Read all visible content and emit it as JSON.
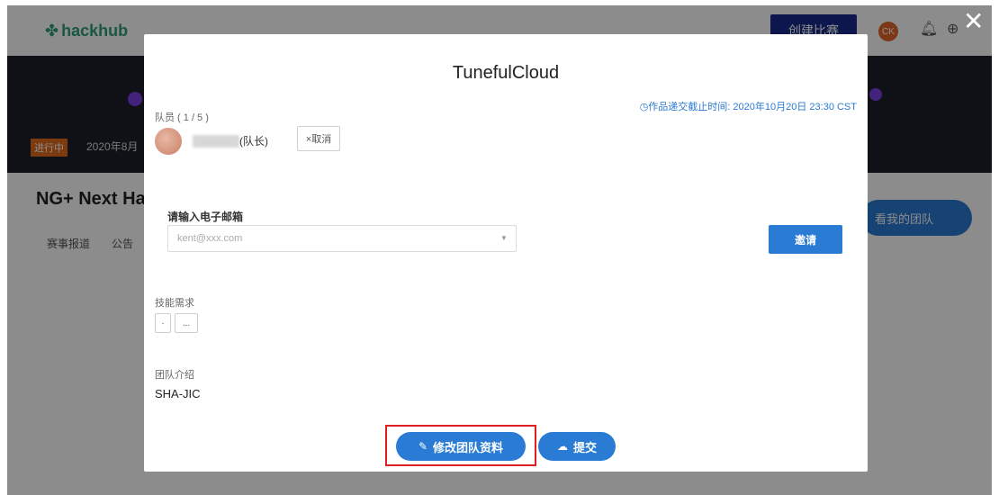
{
  "background": {
    "logo": "hackhub",
    "create_button": "创建比赛",
    "avatar_initials": "CK",
    "status_tag": "进行中",
    "date": "2020年8月",
    "event_title": "NG+ Next Ha",
    "tabs": [
      "赛事报道",
      "公告"
    ],
    "my_team_button": "看我的团队"
  },
  "modal": {
    "title": "TunefulCloud",
    "deadline": "作品递交截止时间: 2020年10月20日 23:30 CST",
    "members_label": "队员 ( 1 / 5 )",
    "member_role": "(队长)",
    "cancel_label": "×取消",
    "email_label": "请输入电子邮箱",
    "email_placeholder": "kent@xxx.com",
    "invite_label": "邀请",
    "skills_label": "技能需求",
    "skills": [
      "·",
      "..."
    ],
    "intro_label": "团队介绍",
    "intro_text": "SHA-JIC",
    "edit_label": "修改团队资料",
    "submit_label": "提交"
  },
  "colors": {
    "accent": "#2a7bd3",
    "highlight": "#e02020",
    "status": "#e26a1c"
  },
  "icons": [
    "hackhub-logo-icon",
    "bell-icon",
    "globe-icon",
    "close-icon",
    "clock-icon",
    "pencil-icon",
    "cloud-upload-icon",
    "chevron-down-icon"
  ]
}
